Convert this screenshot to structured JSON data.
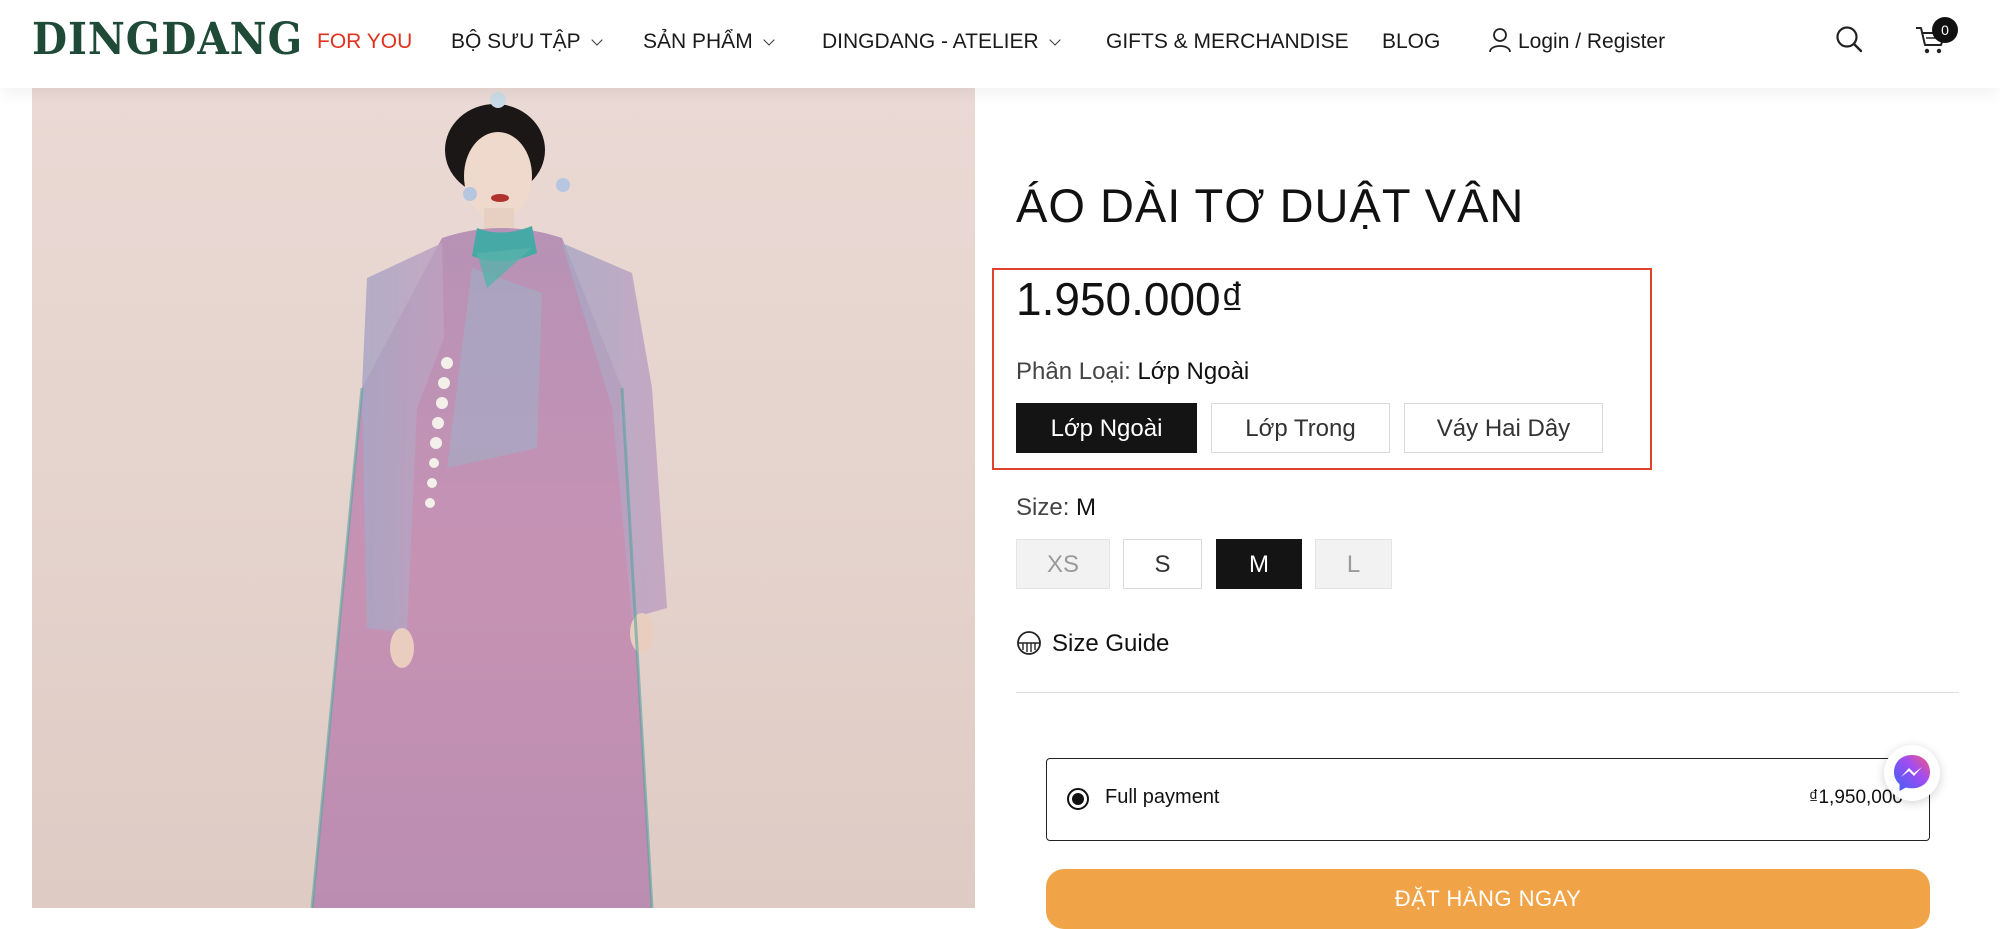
{
  "header": {
    "logo": "DINGDANG",
    "nav": [
      {
        "label": "FOR YOU",
        "active": true,
        "dropdown": false
      },
      {
        "label": "BỘ SƯU TẬP",
        "active": false,
        "dropdown": true
      },
      {
        "label": "SẢN PHẨM",
        "active": false,
        "dropdown": true
      },
      {
        "label": "DINGDANG - ATELIER",
        "active": false,
        "dropdown": true
      },
      {
        "label": "GIFTS & MERCHANDISE",
        "active": false,
        "dropdown": false
      },
      {
        "label": "BLOG",
        "active": false,
        "dropdown": false
      }
    ],
    "login_label": "Login / Register",
    "cart_count": "0",
    "icons": {
      "search": "search-icon",
      "cart": "cart-icon",
      "user": "user-icon"
    }
  },
  "product": {
    "title": "ÁO DÀI TƠ DUẬT VÂN",
    "price": "1.950.000₫",
    "variant": {
      "label": "Phân Loại:",
      "selected": "Lớp Ngoài",
      "options": [
        "Lớp Ngoài",
        "Lớp Trong",
        "Váy Hai Dây"
      ]
    },
    "size": {
      "label": "Size:",
      "selected": "M",
      "options": [
        "XS",
        "S",
        "M",
        "L"
      ],
      "unavailable": [
        "XS",
        "L"
      ]
    },
    "size_guide_label": "Size Guide",
    "payment": {
      "label": "Full payment",
      "amount": "₫1,950,000"
    },
    "order_button": "ĐẶT HÀNG NGAY"
  },
  "colors": {
    "accent_red": "#e0321e",
    "logo_green": "#1f4a38",
    "order_orange": "#f0a447",
    "highlight_border": "#e0432d"
  }
}
